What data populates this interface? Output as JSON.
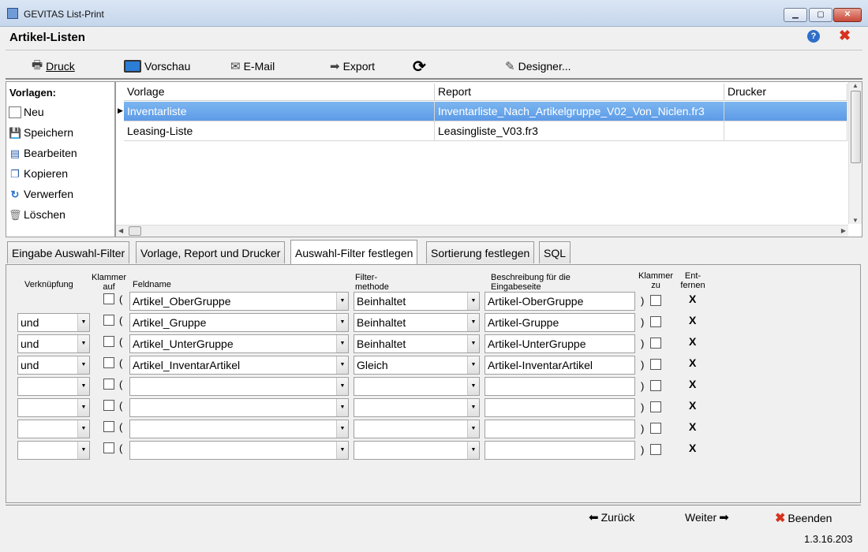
{
  "window": {
    "title": "GEVITAS List-Print",
    "minimize": "▁",
    "maximize": "▢",
    "close": "✕"
  },
  "header": {
    "title": "Artikel-Listen",
    "help": "?",
    "close": "✖"
  },
  "toolbar": {
    "druck": "Druck",
    "vorschau": "Vorschau",
    "email": "E-Mail",
    "export": "Export",
    "refresh": "⟳",
    "designer": "Designer..."
  },
  "left_panel": {
    "label": "Vorlagen:",
    "items": [
      "Neu",
      "Speichern",
      "Bearbeiten",
      "Kopieren",
      "Verwerfen",
      "Löschen"
    ]
  },
  "grid": {
    "columns": [
      "Vorlage",
      "Report",
      "Drucker"
    ],
    "rows": [
      {
        "vorlage": "Inventarliste",
        "report": "Inventarliste_Nach_Artikelgruppe_V02_Von_Niclen.fr3",
        "drucker": ""
      },
      {
        "vorlage": "Leasing-Liste",
        "report": "Leasingliste_V03.fr3",
        "drucker": ""
      }
    ]
  },
  "tabs": [
    "Eingabe Auswahl-Filter",
    "Vorlage, Report und Drucker",
    "Auswahl-Filter festlegen",
    "Sortierung festlegen",
    "SQL"
  ],
  "filter_headers": {
    "verknuepfung": "Verknüpfung",
    "klammer_auf_1": "Klammer",
    "klammer_auf_2": "auf",
    "feldname": "Feldname",
    "methode_1": "Filter-",
    "methode_2": "methode",
    "beschreibung_1": "Beschreibung für die",
    "beschreibung_2": "Eingabeseite",
    "klammer_zu_1": "Klammer",
    "klammer_zu_2": "zu",
    "entfernen_1": "Ent-",
    "entfernen_2": "fernen"
  },
  "filter_rows": [
    {
      "verknuepfung": "",
      "feldname": "Artikel_OberGruppe",
      "methode": "Beinhaltet",
      "beschreibung": "Artikel-OberGruppe"
    },
    {
      "verknuepfung": "und",
      "feldname": "Artikel_Gruppe",
      "methode": "Beinhaltet",
      "beschreibung": "Artikel-Gruppe"
    },
    {
      "verknuepfung": "und",
      "feldname": "Artikel_UnterGruppe",
      "methode": "Beinhaltet",
      "beschreibung": "Artikel-UnterGruppe"
    },
    {
      "verknuepfung": "und",
      "feldname": "Artikel_InventarArtikel",
      "methode": "Gleich",
      "beschreibung": "Artikel-InventarArtikel"
    },
    {
      "verknuepfung": "",
      "feldname": "",
      "methode": "",
      "beschreibung": ""
    },
    {
      "verknuepfung": "",
      "feldname": "",
      "methode": "",
      "beschreibung": ""
    },
    {
      "verknuepfung": "",
      "feldname": "",
      "methode": "",
      "beschreibung": ""
    },
    {
      "verknuepfung": "",
      "feldname": "",
      "methode": "",
      "beschreibung": ""
    }
  ],
  "symbols": {
    "paren_open": "(",
    "paren_close": ")",
    "remove": "X"
  },
  "bottom": {
    "zurueck": "Zurück",
    "weiter": "Weiter",
    "beenden": "Beenden"
  },
  "version": "1.3.16.203"
}
